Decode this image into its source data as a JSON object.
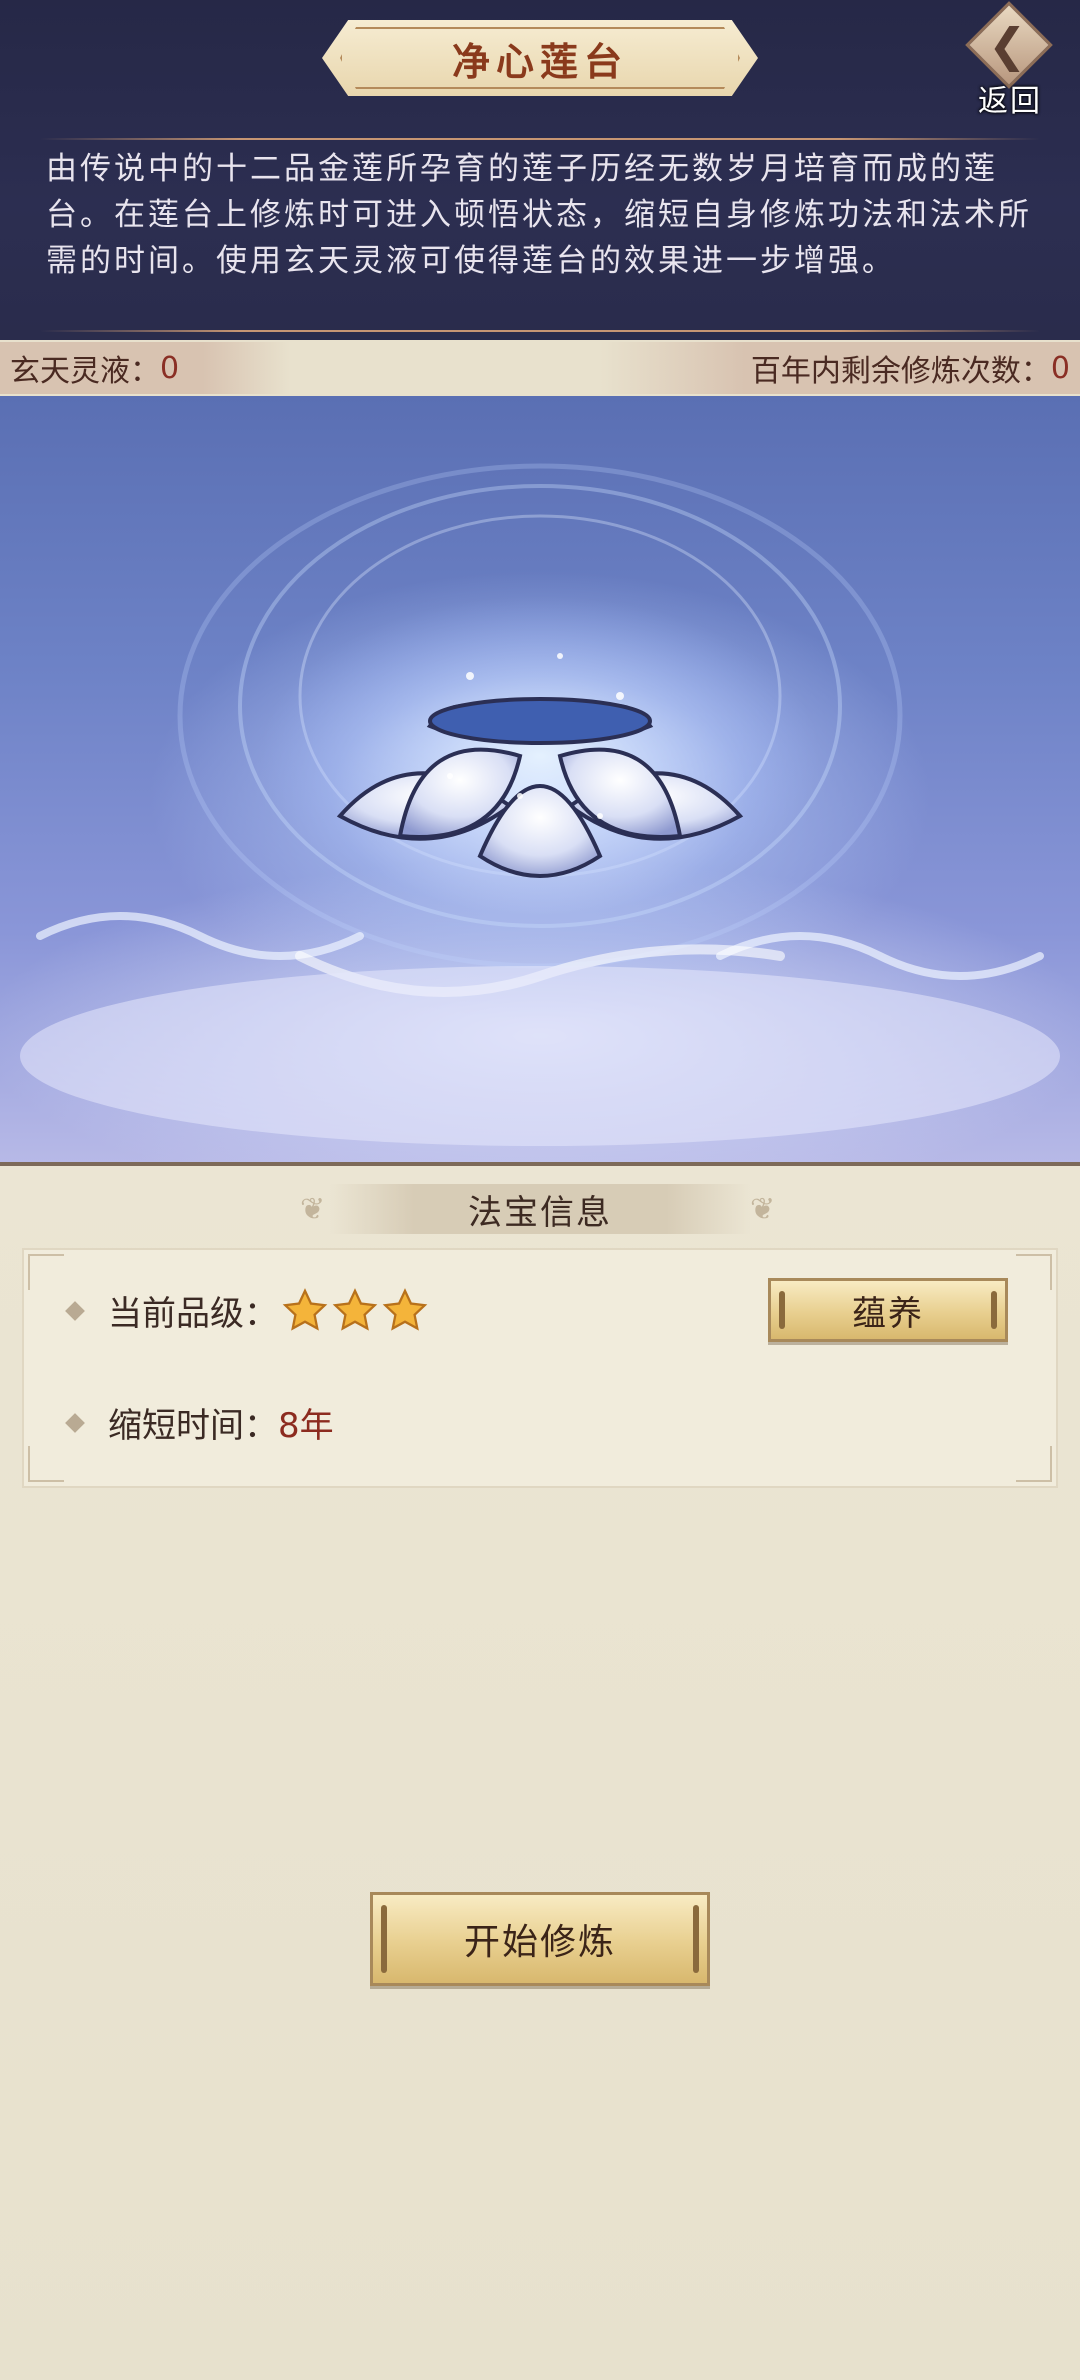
{
  "header": {
    "title": "净心莲台",
    "back_label": "返回",
    "description": "由传说中的十二品金莲所孕育的莲子历经无数岁月培育而成的莲台。在莲台上修炼时可进入顿悟状态，缩短自身修炼功法和法术所需的时间。使用玄天灵液可使得莲台的效果进一步增强。"
  },
  "stats": {
    "liquid_label": "玄天灵液：",
    "liquid_value": "0",
    "remaining_label": "百年内剩余修炼次数：",
    "remaining_value": "0"
  },
  "info": {
    "section_title": "法宝信息",
    "grade_label": "当前品级：",
    "grade_stars": 3,
    "nurture_button": "蕴养",
    "reduce_label": "缩短时间：",
    "reduce_value": "8年"
  },
  "actions": {
    "start_button": "开始修炼"
  },
  "colors": {
    "header_bg": "#2a2c4c",
    "title_text": "#8a3a1c",
    "value_red": "#8c2b1f",
    "panel_bg": "#e8e1cd",
    "button_gold": "#e8cf8f"
  },
  "icons": [
    "back-arrow-icon",
    "star-icon",
    "lotus-platform-image",
    "bullet-diamond-icon"
  ]
}
